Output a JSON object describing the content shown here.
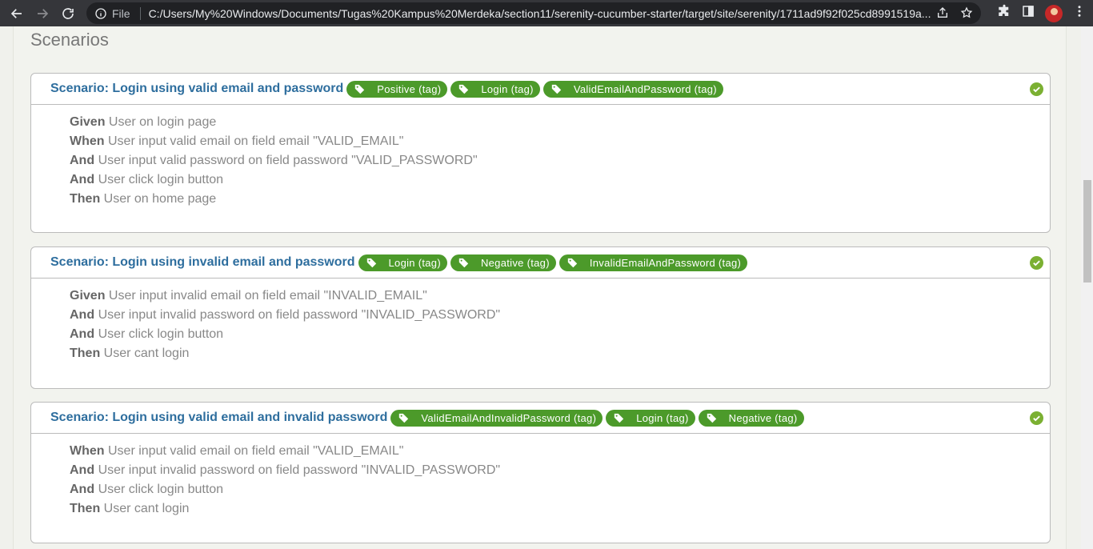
{
  "browser": {
    "file_label": "File",
    "url": "C:/Users/My%20Windows/Documents/Tugas%20Kampus%20Merdeka/section11/serenity-cucumber-starter/target/site/serenity/1711ad9f92f025cd8991519a..."
  },
  "page": {
    "section_title": "Scenarios"
  },
  "scenarios": [
    {
      "title": "Scenario: Login using valid email and password",
      "tags": [
        "Positive (tag)",
        "Login (tag)",
        "ValidEmailAndPassword (tag)"
      ],
      "status": "passed",
      "steps": [
        {
          "keyword": "Given",
          "text": "User on login page"
        },
        {
          "keyword": "When",
          "text": "User input valid email on field email \"VALID_EMAIL\""
        },
        {
          "keyword": "And",
          "text": "User input valid password on field password \"VALID_PASSWORD\""
        },
        {
          "keyword": "And",
          "text": "User click login button"
        },
        {
          "keyword": "Then",
          "text": "User on home page"
        }
      ]
    },
    {
      "title": "Scenario: Login using invalid email and password",
      "tags": [
        "Login (tag)",
        "Negative (tag)",
        "InvalidEmailAndPassword (tag)"
      ],
      "status": "passed",
      "steps": [
        {
          "keyword": "Given",
          "text": "User input invalid email on field email \"INVALID_EMAIL\""
        },
        {
          "keyword": "And",
          "text": "User input invalid password on field password \"INVALID_PASSWORD\""
        },
        {
          "keyword": "And",
          "text": "User click login button"
        },
        {
          "keyword": "Then",
          "text": "User cant login"
        }
      ]
    },
    {
      "title": "Scenario: Login using valid email and invalid password",
      "tags": [
        "ValidEmailAndInvalidPassword (tag)",
        "Login (tag)",
        "Negative (tag)"
      ],
      "status": "passed",
      "steps": [
        {
          "keyword": "When",
          "text": "User input valid email on field email \"VALID_EMAIL\""
        },
        {
          "keyword": "And",
          "text": "User input invalid password on field password \"INVALID_PASSWORD\""
        },
        {
          "keyword": "And",
          "text": "User click login button"
        },
        {
          "keyword": "Then",
          "text": "User cant login"
        }
      ]
    }
  ],
  "colors": {
    "tag_bg": "#4c9a2a",
    "title": "#2e6e9e",
    "status_pass": "#7bb032"
  }
}
